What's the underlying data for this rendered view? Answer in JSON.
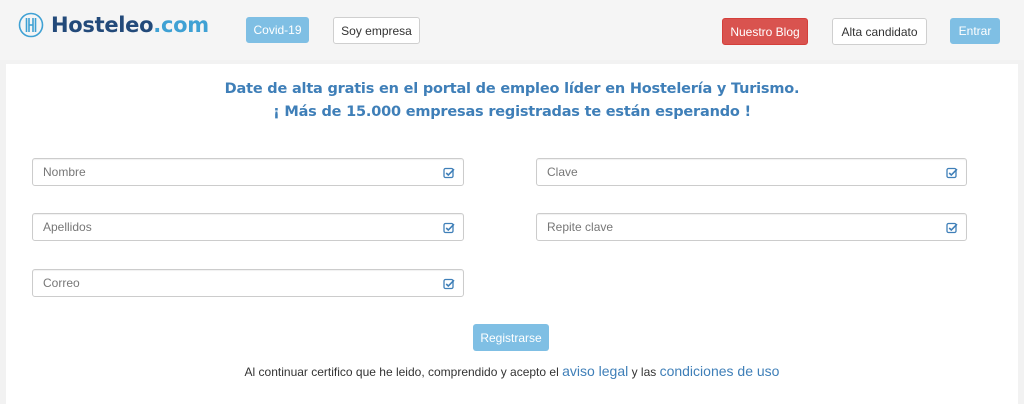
{
  "header": {
    "logo_name": "Hosteleo",
    "logo_domain": ".com",
    "covid_label": "Covid-19",
    "empresa_label": "Soy empresa",
    "blog_label": "Nuestro Blog",
    "candidato_label": "Alta candidato",
    "entrar_label": "Entrar"
  },
  "main": {
    "headline_1": "Date de alta gratis en el portal de empleo líder en Hostelería y Turismo.",
    "headline_2": "¡ Más de 15.000 empresas registradas te están esperando !"
  },
  "form": {
    "nombre_placeholder": "Nombre",
    "apellidos_placeholder": "Apellidos",
    "correo_placeholder": "Correo",
    "clave_placeholder": "Clave",
    "repite_placeholder": "Repite clave",
    "submit_label": "Registrarse"
  },
  "legal": {
    "prefix": "Al continuar certifico que he leido, comprendido y acepto el ",
    "aviso_link": "aviso legal",
    "middle": " y las ",
    "condiciones_link": "condiciones de uso"
  },
  "colors": {
    "brand_dark": "#234a7a",
    "brand_light": "#3fa1d4",
    "accent_blue": "#7fbfe4",
    "headline_blue": "#3f7fb8",
    "danger": "#d9534f"
  },
  "icons": {
    "logo": "hosteleo-logo-icon",
    "field_check": "check-square-icon"
  }
}
